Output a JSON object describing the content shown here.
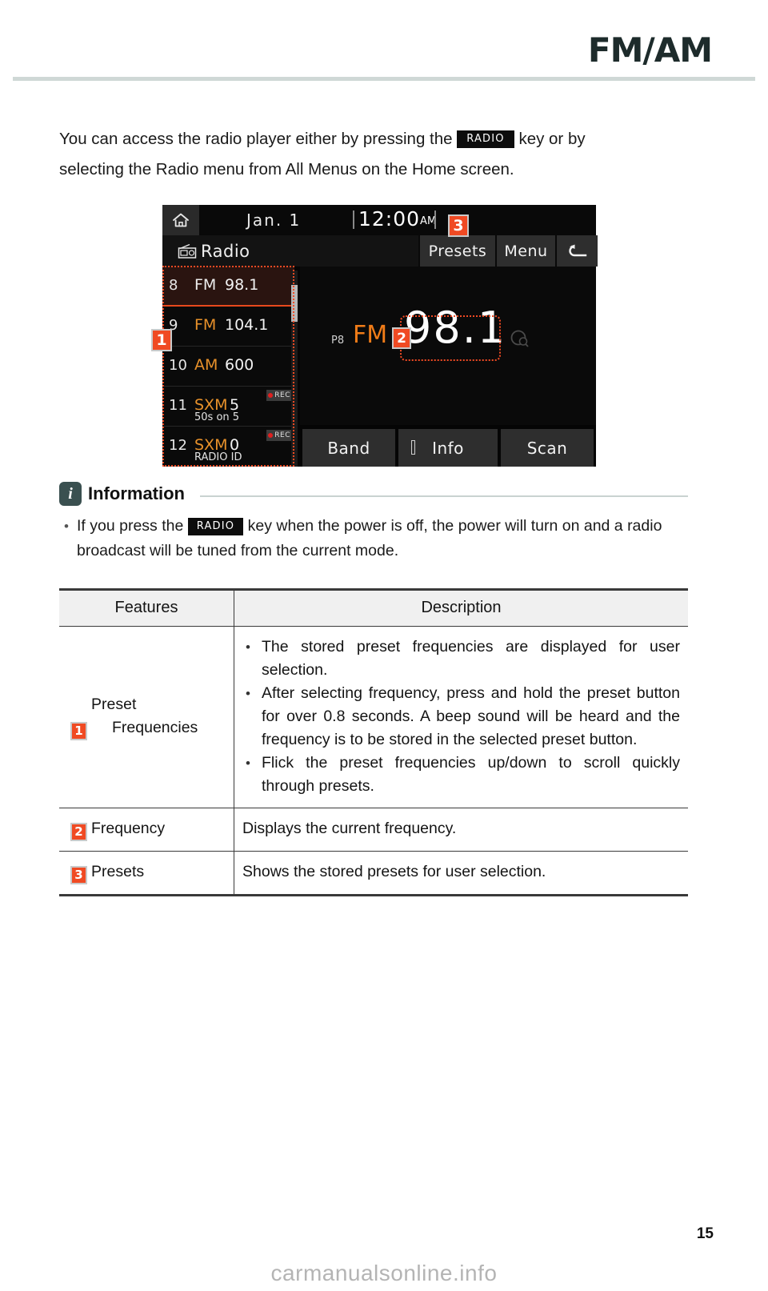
{
  "page": {
    "title": "FM/AM",
    "number": "15",
    "watermark": "carmanualsonline.info"
  },
  "intro": {
    "before_key": "You can access the radio player either by pressing the",
    "key_label": "RADIO",
    "after_key": "key or by",
    "line2": "selecting the Radio menu from All Menus on the Home screen."
  },
  "device": {
    "status_bar": {
      "home_icon": "home-icon",
      "date": "Jan. 1",
      "time": "12:00",
      "meridiem": "AM"
    },
    "app_header": {
      "icon": "radio-icon",
      "title": "Radio",
      "buttons": [
        {
          "label": "Presets",
          "name": "presets-button"
        },
        {
          "label": "Menu",
          "name": "menu-button"
        },
        {
          "label": "back-arrow-icon",
          "name": "back-button"
        }
      ]
    },
    "presets": [
      {
        "num": "8",
        "band": "FM",
        "freq": "98.1",
        "sub": "",
        "rec": false,
        "active": true
      },
      {
        "num": "9",
        "band": "FM",
        "freq": "104.1",
        "sub": "",
        "rec": false,
        "active": false
      },
      {
        "num": "10",
        "band": "AM",
        "freq": "600",
        "sub": "",
        "rec": false,
        "active": false
      },
      {
        "num": "11",
        "band": "SXM",
        "freq": "5",
        "sub": "50s on 5",
        "rec": true,
        "active": false
      },
      {
        "num": "12",
        "band": "SXM",
        "freq": "0",
        "sub": "RADIO ID",
        "rec": true,
        "active": false
      }
    ],
    "rec_label": "REC",
    "display": {
      "preset_number": "P8",
      "band": "FM",
      "frequency": "98.1",
      "search_icon": "search-icon"
    },
    "bottom_buttons": [
      {
        "label": "Band",
        "name": "band-button"
      },
      {
        "label": "Info",
        "name": "info-button"
      },
      {
        "label": "Scan",
        "name": "scan-button"
      }
    ],
    "callouts": [
      {
        "id": "1",
        "target": "preset-frequencies"
      },
      {
        "id": "2",
        "target": "frequency"
      },
      {
        "id": "3",
        "target": "presets"
      }
    ],
    "colors": {
      "accent_orange": "#f04a23",
      "band_orange": "#e8912a",
      "display_orange": "#f07c18",
      "rec_red": "#e02020"
    }
  },
  "information": {
    "icon": "info-icon",
    "title": "Information",
    "bullet": {
      "before_key": "If you press the",
      "key_label": "RADIO",
      "after_key": "key when the power is off, the power will turn on and a radio broadcast will be tuned from the current mode."
    }
  },
  "table": {
    "headers": [
      "Features",
      "Description"
    ],
    "rows": [
      {
        "badge": "1",
        "feature_line1": "Preset",
        "feature_line2": "Frequencies",
        "bullets": [
          "The stored preset frequencies are displayed for user selection.",
          "After selecting frequency, press and hold the preset button for over 0.8 seconds. A beep sound will be heard and the frequency is to be stored in the selected preset button.",
          "Flick the preset frequencies up/down to scroll quickly through presets."
        ],
        "plain": ""
      },
      {
        "badge": "2",
        "feature_line1": "Frequency",
        "feature_line2": "",
        "bullets": [],
        "plain": "Displays the current frequency."
      },
      {
        "badge": "3",
        "feature_line1": "Presets",
        "feature_line2": "",
        "bullets": [],
        "plain": "Shows the stored presets for user selection."
      }
    ]
  }
}
